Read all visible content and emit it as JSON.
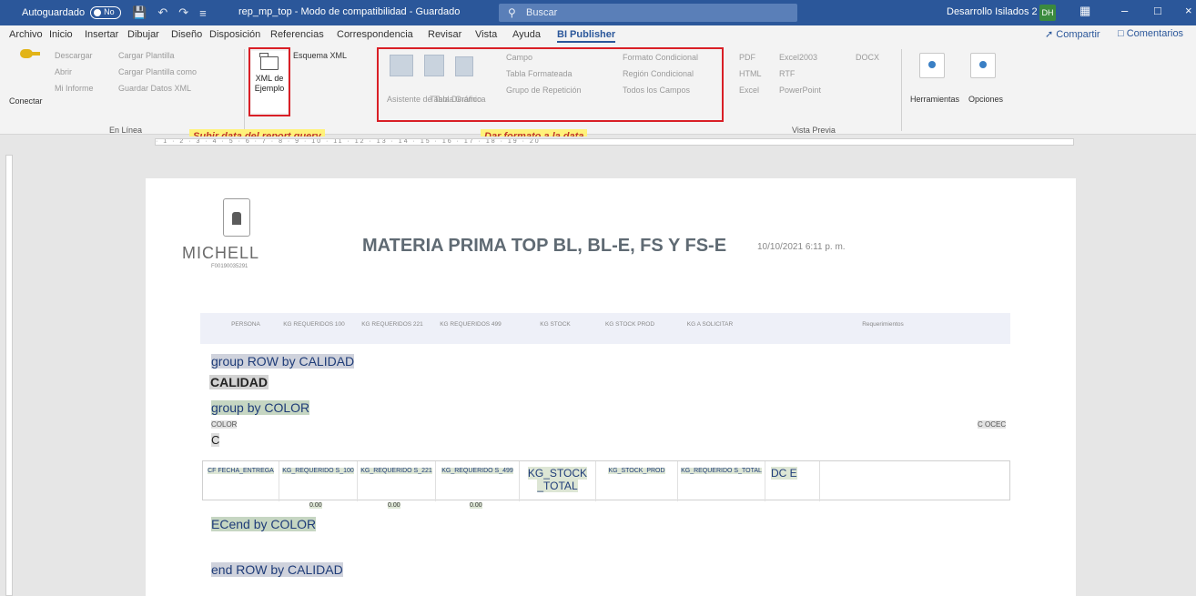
{
  "titlebar": {
    "autosave_label": "Autoguardado",
    "autosave_state": "No",
    "document_title": "rep_mp_top - Modo de compatibilidad - Guardado",
    "search_placeholder": "Buscar",
    "user_name": "Desarrollo Isilados 2",
    "user_initials": "DH"
  },
  "menu_tabs": [
    "Archivo",
    "Inicio",
    "Insertar",
    "Dibujar",
    "Diseño",
    "Disposición",
    "Referencias",
    "Correspondencia",
    "Revisar",
    "Vista",
    "Ayuda",
    "BI Publisher"
  ],
  "active_tab": "BI Publisher",
  "share_label": "Compartir",
  "comments_label": "Comentarios",
  "ribbon": {
    "conectar": "Conectar",
    "online_items": [
      "Descargar",
      "Cargar Plantilla",
      "Abrir",
      "Cargar Plantilla como",
      "Mi Informe",
      "Guardar Datos XML"
    ],
    "online_group": "En Línea",
    "xml_sample": "XML de Ejemplo",
    "xml_schema": "Esquema XML",
    "insert_items": [
      "Asistente de Tabla",
      "Tabla Dinámica",
      "Gráfico",
      "Campo",
      "Tabla Formateada",
      "Grupo de Repetición"
    ],
    "format_items": [
      "Formato Condicional",
      "Región Condicional",
      "Todos los Campos"
    ],
    "preview_items": [
      "PDF",
      "HTML",
      "Excel",
      "Excel2003",
      "RTF",
      "PowerPoint",
      "DOCX"
    ],
    "preview_group": "Vista Previa",
    "tools": "Herramientas",
    "options": "Opciones"
  },
  "callouts": {
    "upload": "Subir data del report query",
    "format": "Dar formato a la data"
  },
  "document": {
    "logo_text": "MICHELL",
    "logo_sub": "F00190035291",
    "title": "MATERIA PRIMA TOP BL, BL-E, FS Y FS-E",
    "date": "10/10/2021 6:11 p. m.",
    "header_cols": [
      "PERSONA",
      "KG REQUERIDOS 100",
      "KG REQUERIDOS 221",
      "KG REQUERIDOS 499",
      "KG STOCK",
      "KG STOCK PROD",
      "KG A SOLICITAR",
      "Requerimientos"
    ],
    "group_row": "group ROW by CALIDAD",
    "calidad": "CALIDAD",
    "group_color": "group by COLOR",
    "color_field": "COLOR",
    "color_right": "C OCEC",
    "c_letter": "C",
    "row_cells": [
      "CF FECHA_ENTREGA",
      "KG_REQUERIDO S_100",
      "KG_REQUERIDO S_221",
      "KG_REQUERIDO S_499",
      "KG_STOCK _TOTAL",
      "KG_STOCK_PROD",
      "KG_REQUERIDO S_TOTAL",
      "DC E"
    ],
    "totals": [
      "0.00",
      "0.00",
      "0.00"
    ],
    "end_color": "ECend by COLOR",
    "end_row": "end ROW by CALIDAD"
  }
}
